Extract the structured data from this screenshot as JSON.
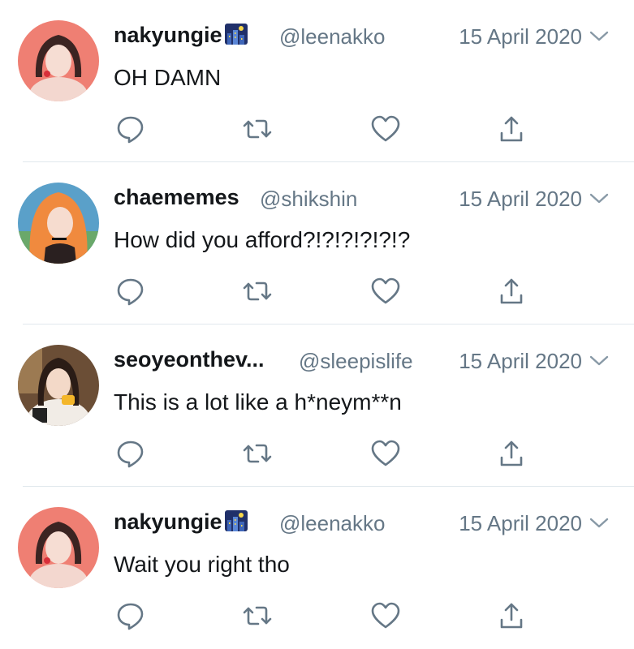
{
  "tweets": [
    {
      "display_name": "nakyungie",
      "has_badge": true,
      "handle": "@leenakko",
      "date": "15 April 2020",
      "text": "OH DAMN",
      "avatar_color": "#e8756b"
    },
    {
      "display_name": "chaememes",
      "has_badge": false,
      "handle": "@shikshin",
      "date": "15 April 2020",
      "text": "How did you afford?!?!?!?!?!?",
      "avatar_color": "#f2a560"
    },
    {
      "display_name": "seoyeonthev...",
      "has_badge": false,
      "handle": "@sleepislife",
      "date": "15 April 2020",
      "text": "This is a lot like a h*neym**n",
      "avatar_color": "#8a6a4a"
    },
    {
      "display_name": "nakyungie",
      "has_badge": true,
      "handle": "@leenakko",
      "date": "15 April 2020",
      "text": "Wait you right tho",
      "avatar_color": "#e8756b"
    }
  ],
  "icons": {
    "reply": "reply-icon",
    "retweet": "retweet-icon",
    "like": "heart-icon",
    "share": "share-icon",
    "caret": "chevron-down-icon",
    "badge": "night-city-emoji-icon"
  },
  "colors": {
    "name": "#14171a",
    "secondary": "#657786",
    "icon": "#657786",
    "divider": "#e1e8ed"
  }
}
